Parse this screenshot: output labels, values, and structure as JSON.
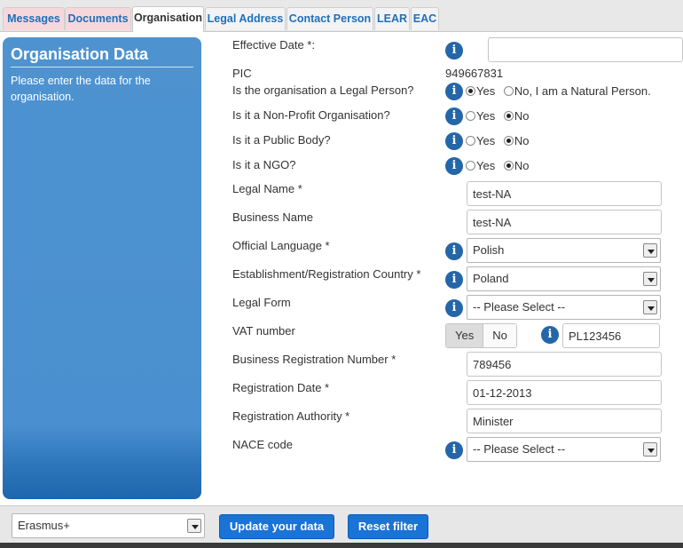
{
  "tabs": [
    {
      "label": "Messages",
      "state": "pink"
    },
    {
      "label": "Documents",
      "state": "pink"
    },
    {
      "label": "Organisation",
      "state": "active"
    },
    {
      "label": "Legal Address",
      "state": "plain"
    },
    {
      "label": "Contact Person",
      "state": "plain"
    },
    {
      "label": "LEAR",
      "state": "plain"
    },
    {
      "label": "EAC",
      "state": "plain"
    }
  ],
  "sidebar": {
    "title": "Organisation Data",
    "description": "Please enter the data for the organisation."
  },
  "form": {
    "effective_date": {
      "label": "Effective Date *:",
      "value": ""
    },
    "pic": {
      "label": "PIC",
      "value": "949667831"
    },
    "legal_person": {
      "label": "Is the organisation a Legal Person?",
      "yes": "Yes",
      "no": "No, I am a Natural Person.",
      "selected": "yes"
    },
    "non_profit": {
      "label": "Is it a Non-Profit Organisation?",
      "yes": "Yes",
      "no": "No",
      "selected": "no"
    },
    "public_body": {
      "label": "Is it a Public Body?",
      "yes": "Yes",
      "no": "No",
      "selected": "no"
    },
    "ngo": {
      "label": "Is it a NGO?",
      "yes": "Yes",
      "no": "No",
      "selected": "no"
    },
    "legal_name": {
      "label": "Legal Name *",
      "value": "test-NA"
    },
    "business_name": {
      "label": "Business Name",
      "value": "test-NA"
    },
    "official_language": {
      "label": "Official Language *",
      "value": "Polish"
    },
    "country": {
      "label": "Establishment/Registration Country *",
      "value": "Poland"
    },
    "legal_form": {
      "label": "Legal Form",
      "value": "-- Please Select --"
    },
    "vat": {
      "label": "VAT number",
      "yes": "Yes",
      "no": "No",
      "selected": "yes",
      "value": "PL123456"
    },
    "business_reg_number": {
      "label": "Business Registration Number *",
      "value": "789456"
    },
    "registration_date": {
      "label": "Registration Date *",
      "value": "01-12-2013"
    },
    "registration_authority": {
      "label": "Registration Authority *",
      "value": "Minister"
    },
    "nace_code": {
      "label": "NACE code",
      "value": "-- Please Select --"
    }
  },
  "footer": {
    "programme": "Erasmus+",
    "update_label": "Update your data",
    "reset_label": "Reset filter"
  },
  "colors": {
    "tab_text": "#1f6fb8",
    "tab_pink": "#f6d8dc",
    "sidebar_blue": "#4a8fcf",
    "info_icon": "#2466a8",
    "button_blue": "#1a73d6"
  }
}
